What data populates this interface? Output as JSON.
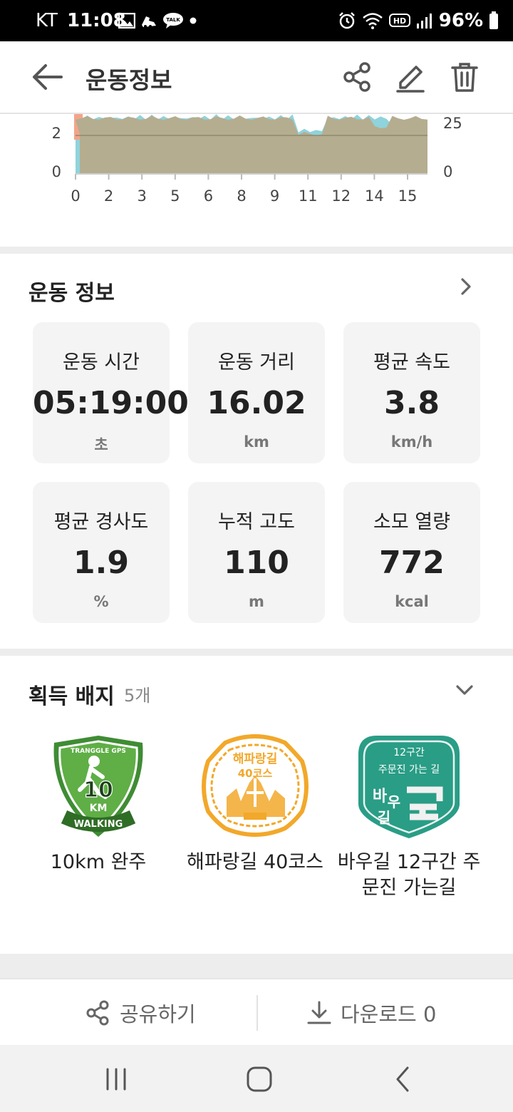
{
  "status_bar": {
    "carrier": "KT",
    "time": "11:08",
    "notification_icons": [
      "image-icon",
      "running-shoe-icon",
      "talk-icon",
      "dot-icon"
    ],
    "right_icons": [
      "alarm-icon",
      "wifi-icon",
      "hd-icon",
      "signal-icon"
    ],
    "battery": "96%"
  },
  "app_bar": {
    "title": "운동정보",
    "icons": [
      "back-arrow-icon",
      "share-icon",
      "edit-icon",
      "trash-icon"
    ]
  },
  "chart_data": {
    "type": "area",
    "series": [
      {
        "name": "",
        "color": "#8fd3dc"
      },
      {
        "name": "",
        "color": "#f3a48a"
      },
      {
        "name": "",
        "color": "#b5ad90"
      }
    ],
    "x_ticks": [
      "0",
      "2",
      "3",
      "5",
      "6",
      "8",
      "9",
      "11",
      "12",
      "14",
      "15"
    ],
    "left_axis_ticks": [
      "2",
      "0"
    ],
    "right_axis_ticks": [
      "25",
      "0"
    ],
    "grid": true
  },
  "workout_info": {
    "title": "운동 정보",
    "stats": [
      {
        "label": "운동 시간",
        "value": "05:19:00",
        "unit": "초"
      },
      {
        "label": "운동 거리",
        "value": "16.02",
        "unit": "km"
      },
      {
        "label": "평균 속도",
        "value": "3.8",
        "unit": "km/h"
      },
      {
        "label": "평균 경사도",
        "value": "1.9",
        "unit": "%"
      },
      {
        "label": "누적 고도",
        "value": "110",
        "unit": "m"
      },
      {
        "label": "소모 열량",
        "value": "772",
        "unit": "kcal"
      }
    ]
  },
  "badges": {
    "title": "획득 배지",
    "count": "5개",
    "items": [
      {
        "name": "10km 완주",
        "art_text": [
          "TRANGGLE GPS",
          "10",
          "KM",
          "WALKING"
        ]
      },
      {
        "name": "해파랑길 40코스",
        "art_text": [
          "해파랑길",
          "40코스"
        ]
      },
      {
        "name_line1": "바우길 12구간 주",
        "name_line2": "문진 가는길",
        "art_text": [
          "12구간",
          "주문진 가는 길",
          "바",
          "우",
          "길"
        ]
      }
    ]
  },
  "actions": {
    "share_label": "공유하기",
    "download_label": "다운로드 0"
  },
  "nav_bar": [
    "recent-apps-icon",
    "home-icon",
    "back-icon"
  ]
}
